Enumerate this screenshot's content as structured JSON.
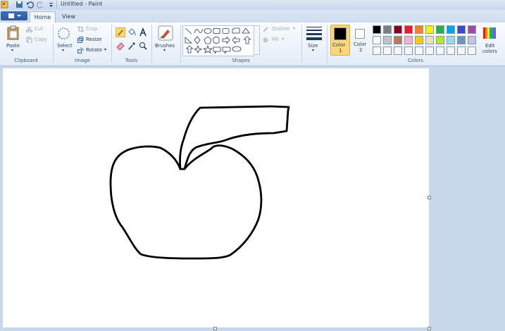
{
  "window": {
    "title": "Untitled - Paint"
  },
  "tabs": [
    {
      "label": "Home"
    },
    {
      "label": "View"
    }
  ],
  "clipboard": {
    "paste": "Paste",
    "cut": "Cut",
    "copy": "Copy",
    "group": "Clipboard"
  },
  "image": {
    "select": "Select",
    "crop": "Crop",
    "resize": "Resize",
    "rotate": "Rotate",
    "group": "Image"
  },
  "tools": {
    "group": "Tools"
  },
  "brushes": {
    "label": "Brushes"
  },
  "shapes": {
    "outline": "Outline",
    "fill": "Fill",
    "group": "Shapes"
  },
  "size": {
    "label": "Size"
  },
  "colors": {
    "color1_label": "Color",
    "color1_num": "1",
    "color2_label": "Color",
    "color2_num": "2",
    "edit_label": "Edit",
    "edit_label2": "colors",
    "group": "Colors",
    "color1": "#000000",
    "color2": "#ffffff",
    "palette_row1": [
      "#000000",
      "#7f7f7f",
      "#880015",
      "#ed1c24",
      "#ff7f27",
      "#fff200",
      "#22b14c",
      "#00a2e8",
      "#3f48cc",
      "#a349a4"
    ],
    "palette_row2": [
      "#ffffff",
      "#c3c3c3",
      "#b97a57",
      "#ffaec9",
      "#ffc90e",
      "#efe4b0",
      "#b5e61d",
      "#99d9ea",
      "#7092be",
      "#c8bfe7"
    ],
    "palette_row3": [
      "#f7f7f7",
      "#f7f7f7",
      "#f7f7f7",
      "#f7f7f7",
      "#f7f7f7",
      "#f7f7f7",
      "#f7f7f7",
      "#f7f7f7",
      "#f7f7f7",
      "#f7f7f7"
    ]
  }
}
